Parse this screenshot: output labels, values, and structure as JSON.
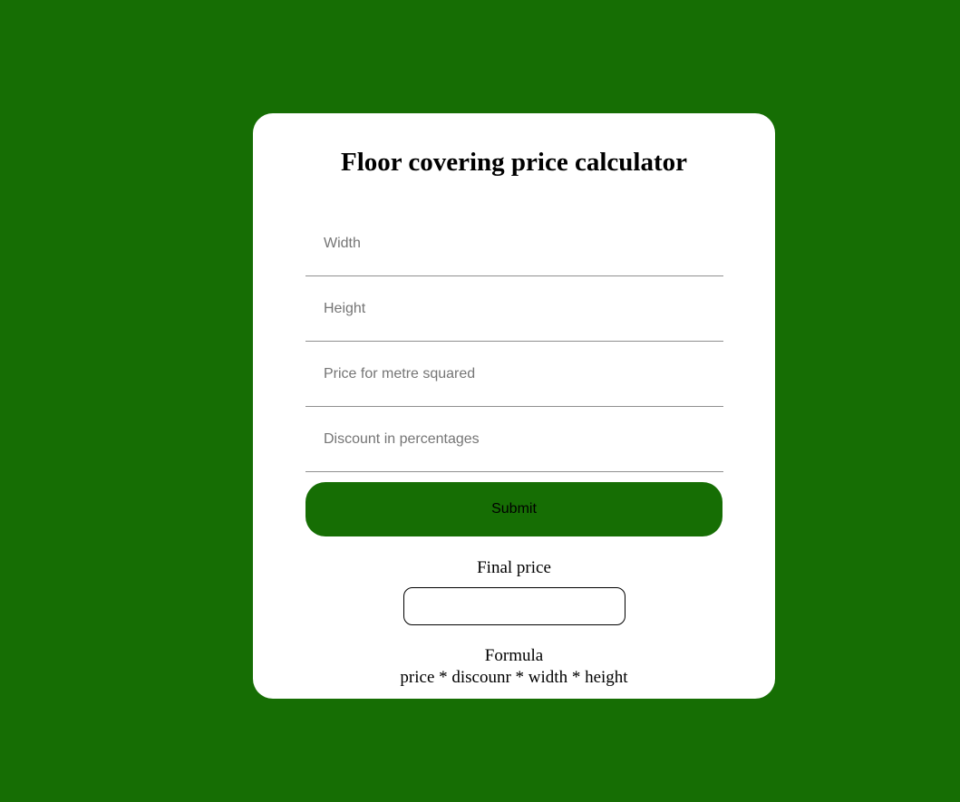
{
  "page": {
    "background_color": "#166e04",
    "card_color": "#ffffff"
  },
  "form": {
    "title": "Floor covering price calculator",
    "fields": {
      "width": {
        "placeholder": "Width",
        "value": ""
      },
      "height": {
        "placeholder": "Height",
        "value": ""
      },
      "price": {
        "placeholder": "Price for metre squared",
        "value": ""
      },
      "discount": {
        "placeholder": "Discount in percentages",
        "value": ""
      }
    },
    "submit_label": "Submit",
    "submit_color": "#166e04"
  },
  "result": {
    "final_price_label": "Final price",
    "final_price_value": ""
  },
  "formula": {
    "label": "Formula",
    "text": "price * discounr * width * height"
  }
}
